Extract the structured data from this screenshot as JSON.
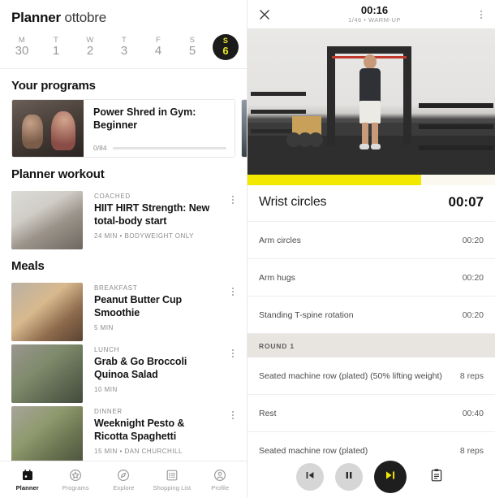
{
  "left": {
    "header": {
      "title_bold": "Planner",
      "month": "ottobre"
    },
    "week": [
      {
        "dow": "M",
        "num": "30",
        "active": false
      },
      {
        "dow": "T",
        "num": "1",
        "active": false
      },
      {
        "dow": "W",
        "num": "2",
        "active": false
      },
      {
        "dow": "T",
        "num": "3",
        "active": false
      },
      {
        "dow": "F",
        "num": "4",
        "active": false
      },
      {
        "dow": "S",
        "num": "5",
        "active": false
      },
      {
        "dow": "S",
        "num": "6",
        "active": true
      }
    ],
    "programs_title": "Your programs",
    "program_card": {
      "title": "Power Shred in Gym: Beginner",
      "progress_label": "0/84",
      "progress_percent": 0
    },
    "workout_title": "Planner workout",
    "workout": {
      "kicker": "COACHED",
      "name": "HIIT HIRT Strength: New total-body start",
      "sub": "24 MIN • BODYWEIGHT ONLY"
    },
    "meals_title": "Meals",
    "meals": [
      {
        "kicker": "BREAKFAST",
        "name": "Peanut Butter Cup Smoothie",
        "sub": "5 MIN"
      },
      {
        "kicker": "LUNCH",
        "name": "Grab & Go Broccoli Quinoa Salad",
        "sub": "10 MIN"
      },
      {
        "kicker": "DINNER",
        "name": "Weeknight Pesto & Ricotta Spaghetti",
        "sub": "15 MIN • DAN CHURCHILL"
      }
    ],
    "nav": [
      {
        "label": "Planner",
        "icon": "calendar-icon",
        "active": true
      },
      {
        "label": "Programs",
        "icon": "star-badge-icon",
        "active": false
      },
      {
        "label": "Explore",
        "icon": "compass-icon",
        "active": false
      },
      {
        "label": "Shopping List",
        "icon": "list-icon",
        "active": false
      },
      {
        "label": "Profile",
        "icon": "person-icon",
        "active": false
      }
    ]
  },
  "right": {
    "header": {
      "close_icon": "close-icon",
      "clock": "00:16",
      "meta": "1/46 • WARM-UP",
      "menu_icon": "kebab-menu-icon"
    },
    "progress_percent": 70,
    "current": {
      "name": "Wrist circles",
      "time": "00:07"
    },
    "rows": [
      {
        "type": "exercise",
        "name": "Arm circles",
        "value": "00:20"
      },
      {
        "type": "exercise",
        "name": "Arm hugs",
        "value": "00:20"
      },
      {
        "type": "exercise",
        "name": "Standing T-spine rotation",
        "value": "00:20"
      },
      {
        "type": "round",
        "name": "ROUND 1",
        "value": ""
      },
      {
        "type": "exercise",
        "name": "Seated machine row (plated) (50% lifting weight)",
        "value": "8 reps"
      },
      {
        "type": "exercise",
        "name": "Rest",
        "value": "00:40"
      },
      {
        "type": "exercise",
        "name": "Seated machine row (plated)",
        "value": "8 reps"
      }
    ],
    "controls": {
      "previous_label": "previous-track-icon",
      "pause_label": "pause-icon",
      "next_label": "next-track-icon",
      "notes_label": "clipboard-icon"
    }
  },
  "colors": {
    "accent_yellow": "#f2e800",
    "dark": "#1e1e1e",
    "round_band": "#e8e5e0"
  }
}
